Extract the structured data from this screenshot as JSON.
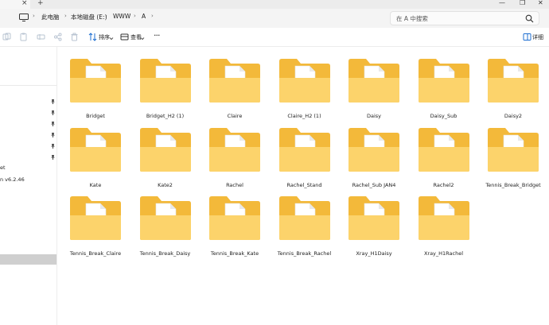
{
  "window": {
    "tab_close": "×",
    "new_tab": "+",
    "minimize": "—",
    "maximize": "❐",
    "close": "✕"
  },
  "address": {
    "crumbs": [
      "此电脑",
      "本地磁盘 (E:)",
      "WWW",
      "A"
    ],
    "separator": "›",
    "search_placeholder": "在 A 中搜索"
  },
  "toolbar": {
    "sort_label": "排序",
    "view_label": "查看",
    "more": "···",
    "details_label": "详细"
  },
  "nav": {
    "partial_items": [
      "et",
      "n v6.2.46"
    ]
  },
  "folders": [
    "Bridget",
    "Bridget_H2 (1)",
    "Claire",
    "Claire_H2 (1)",
    "Daisy",
    "Daisy_Sub",
    "Daisy2",
    "Kate",
    "Kate2",
    "Rachel",
    "Rachel_Stand",
    "Rachel_Sub JAN4",
    "Rachel2",
    "Tennis_Break_Bridget",
    "Tennis_Break_Claire",
    "Tennis_Break_Daisy",
    "Tennis_Break_Kate",
    "Tennis_Break_Rachel",
    "Xray_H1Daisy",
    "Xray_H1Rachel"
  ],
  "colors": {
    "folder_back": "#f3b93a",
    "folder_front": "#fcd36b",
    "paper": "#ffffff"
  }
}
